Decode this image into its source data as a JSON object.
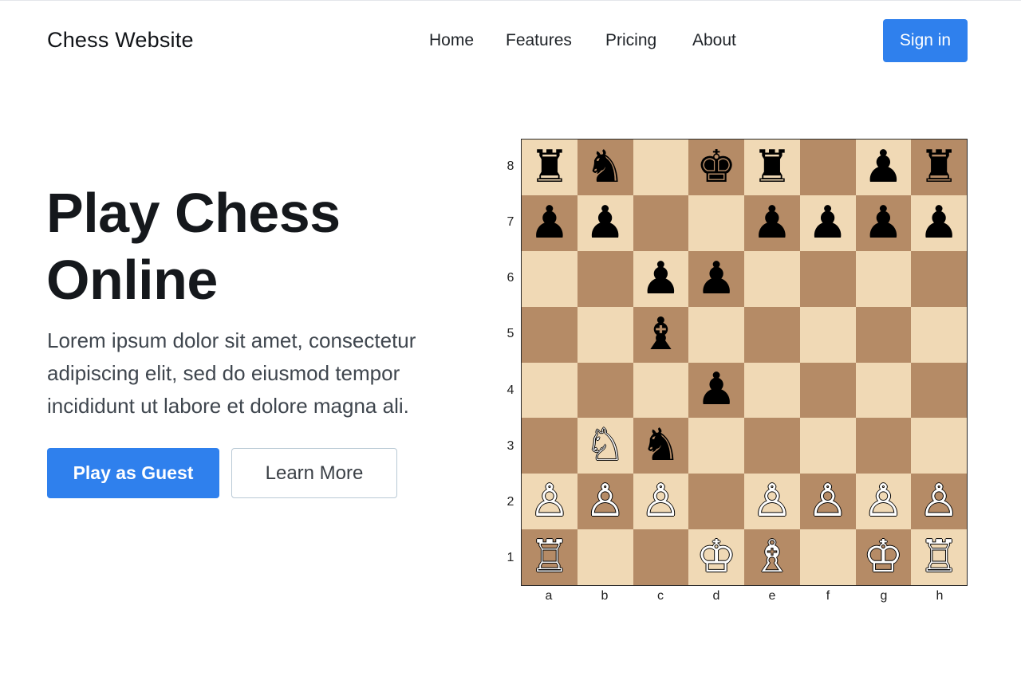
{
  "header": {
    "brand": "Chess Website",
    "nav": [
      "Home",
      "Features",
      "Pricing",
      "About"
    ],
    "sign_in_label": "Sign in"
  },
  "hero": {
    "title": "Play Chess Online",
    "description": "Lorem ipsum dolor sit amet, consectetur adipiscing elit, sed do eiusmod tempor incididunt ut labore et dolore magna ali.",
    "primary_button": "Play as Guest",
    "secondary_button": "Learn More"
  },
  "colors": {
    "accent": "#2f80ed",
    "board_light": "#f0d9b5",
    "board_dark": "#b58b66"
  },
  "board": {
    "orientation": "white-bottom",
    "ranks": [
      "8",
      "7",
      "6",
      "5",
      "4",
      "3",
      "2",
      "1"
    ],
    "files": [
      "a",
      "b",
      "c",
      "d",
      "e",
      "f",
      "g",
      "h"
    ],
    "pieces": [
      {
        "square": "a8",
        "color": "black",
        "type": "rook"
      },
      {
        "square": "b8",
        "color": "black",
        "type": "knight"
      },
      {
        "square": "d8",
        "color": "black",
        "type": "king"
      },
      {
        "square": "e8",
        "color": "black",
        "type": "rook"
      },
      {
        "square": "g8",
        "color": "black",
        "type": "pawn"
      },
      {
        "square": "h8",
        "color": "black",
        "type": "rook"
      },
      {
        "square": "a7",
        "color": "black",
        "type": "pawn"
      },
      {
        "square": "b7",
        "color": "black",
        "type": "pawn"
      },
      {
        "square": "e7",
        "color": "black",
        "type": "pawn"
      },
      {
        "square": "f7",
        "color": "black",
        "type": "pawn"
      },
      {
        "square": "g7",
        "color": "black",
        "type": "pawn"
      },
      {
        "square": "h7",
        "color": "black",
        "type": "pawn"
      },
      {
        "square": "c6",
        "color": "black",
        "type": "pawn"
      },
      {
        "square": "d6",
        "color": "black",
        "type": "pawn"
      },
      {
        "square": "c5",
        "color": "black",
        "type": "bishop"
      },
      {
        "square": "d4",
        "color": "black",
        "type": "pawn"
      },
      {
        "square": "b3",
        "color": "white",
        "type": "knight"
      },
      {
        "square": "c3",
        "color": "black",
        "type": "knight"
      },
      {
        "square": "a2",
        "color": "white",
        "type": "pawn"
      },
      {
        "square": "b2",
        "color": "white",
        "type": "pawn"
      },
      {
        "square": "c2",
        "color": "white",
        "type": "pawn"
      },
      {
        "square": "e2",
        "color": "white",
        "type": "pawn"
      },
      {
        "square": "f2",
        "color": "white",
        "type": "pawn"
      },
      {
        "square": "g2",
        "color": "white",
        "type": "pawn"
      },
      {
        "square": "h2",
        "color": "white",
        "type": "pawn"
      },
      {
        "square": "a1",
        "color": "white",
        "type": "rook"
      },
      {
        "square": "d1",
        "color": "white",
        "type": "king"
      },
      {
        "square": "e1",
        "color": "white",
        "type": "bishop"
      },
      {
        "square": "g1",
        "color": "white",
        "type": "king"
      },
      {
        "square": "h1",
        "color": "white",
        "type": "rook"
      }
    ]
  }
}
